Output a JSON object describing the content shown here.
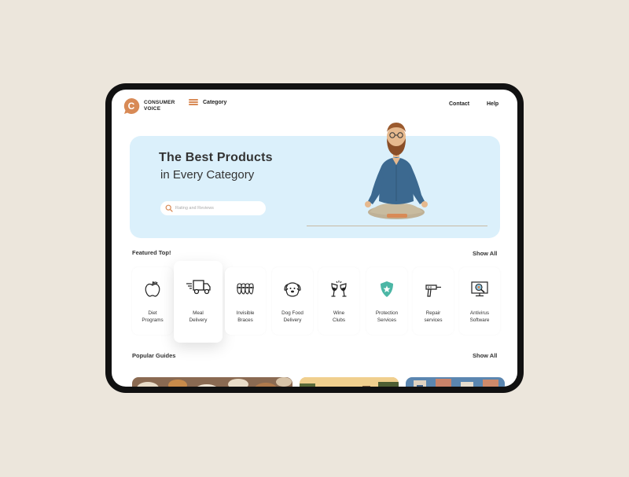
{
  "app": {
    "brand_line1": "CONSUMER",
    "brand_line2": "VOICE",
    "logo_letter": "C"
  },
  "header": {
    "category_label": "Category",
    "nav": [
      {
        "label": "Contact"
      },
      {
        "label": "Help"
      }
    ]
  },
  "hero": {
    "title": "The Best Products",
    "subtitle": "in Every Category",
    "search_placeholder": "Rating and Reviews",
    "illustration": "meditating-man-illustration"
  },
  "featured": {
    "title": "Featured Top!",
    "show_all": "Show All",
    "items": [
      {
        "line1": "Diet",
        "line2": "Programs",
        "icon": "apple-icon"
      },
      {
        "line1": "Meal",
        "line2": "Delivery",
        "icon": "delivery-truck-icon",
        "active": true
      },
      {
        "line1": "Invisible",
        "line2": "Braces",
        "icon": "braces-icon"
      },
      {
        "line1": "Dog Food",
        "line2": "Delivery",
        "icon": "dog-icon"
      },
      {
        "line1": "Wine",
        "line2": "Clubs",
        "icon": "wine-glasses-icon"
      },
      {
        "line1": "Protection",
        "line2": "Services",
        "icon": "shield-star-icon"
      },
      {
        "line1": "Repair",
        "line2": "services",
        "icon": "drill-icon"
      },
      {
        "line1": "Antivirus",
        "line2": "Software",
        "icon": "antivirus-monitor-icon"
      }
    ]
  },
  "guides": {
    "title": "Popular Guides",
    "show_all": "Show All",
    "cards": [
      {
        "image": "food-table-photo"
      },
      {
        "image": "city-street-photo"
      },
      {
        "image": "building-facade-photo"
      }
    ]
  },
  "colors": {
    "accent": "#d88a56",
    "hero_bg": "#dbf0fb",
    "page_bg": "#ece6dc",
    "shield": "#4bb6a5"
  }
}
